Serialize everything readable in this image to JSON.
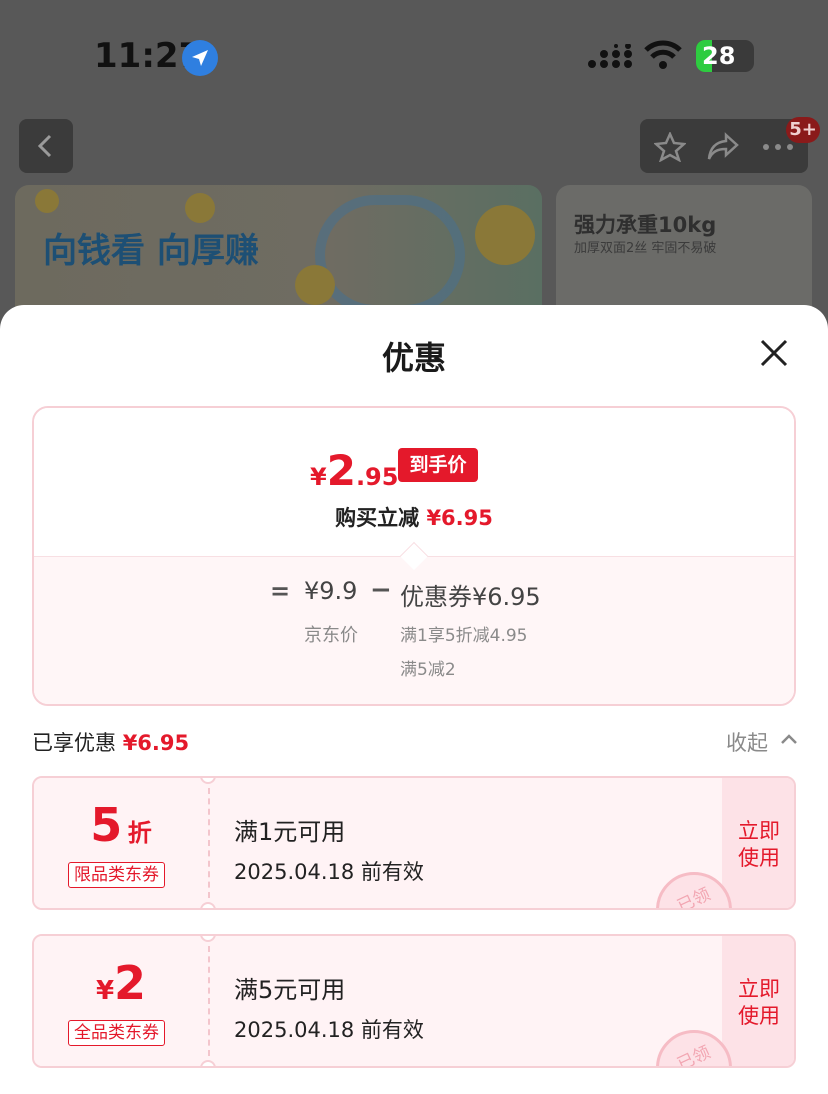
{
  "status_bar": {
    "time": "11:27",
    "battery": "28"
  },
  "background": {
    "banner_left_slogan": "向钱看 向厚赚",
    "banner_right_title": "强力承重10kg",
    "banner_right_sub": "加厚双面2丝 牢固不易破",
    "nav_badge": "5+"
  },
  "sheet": {
    "title": "优惠",
    "price_card": {
      "currency": "¥",
      "final_int": "2",
      "final_dec": ".95",
      "final_tag": "到手价",
      "discount_label": "购买立减",
      "discount_value": "¥6.95",
      "equals": "=",
      "original_price": "¥9.9",
      "original_label": "京东价",
      "minus": "−",
      "coupon_total": "优惠券¥6.95",
      "coupon_detail_1": "满1享5折减4.95",
      "coupon_detail_2": "满5减2"
    },
    "enjoyed_label": "已享优惠",
    "enjoyed_value": "¥6.95",
    "collapse_label": "收起",
    "coupons": [
      {
        "amount_number": "5",
        "amount_unit": "折",
        "scope": "限品类东券",
        "condition": "满1元可用",
        "valid_until": "2025.04.18 前有效",
        "action": "立即使用",
        "stamp": "已领"
      },
      {
        "amount_prefix": "¥",
        "amount_number": "2",
        "scope": "全品类东券",
        "condition": "满5元可用",
        "valid_until": "2025.04.18 前有效",
        "action": "立即使用",
        "stamp": "已领"
      }
    ]
  },
  "colors": {
    "accent_red": "#e4192b",
    "coupon_bg": "#fff3f5",
    "coupon_border": "#f6cfd5"
  }
}
